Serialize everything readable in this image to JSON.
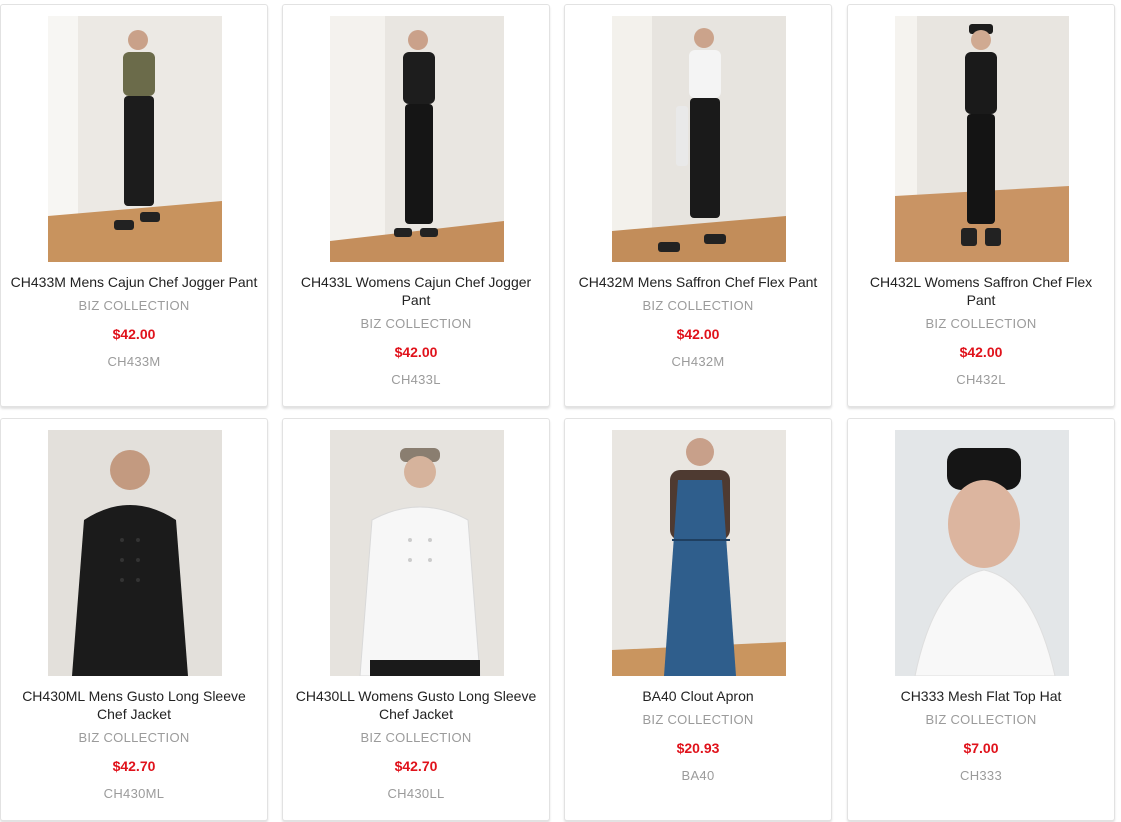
{
  "colors": {
    "price": "#e0121b",
    "muted": "#9b9b9b",
    "title": "#222222"
  },
  "products": [
    {
      "title": "CH433M Mens Cajun Chef Jogger Pant",
      "brand": "BIZ COLLECTION",
      "price": "$42.00",
      "sku": "CH433M",
      "image_icon": "person-standing-icon"
    },
    {
      "title": "CH433L Womens Cajun Chef Jogger Pant",
      "brand": "BIZ COLLECTION",
      "price": "$42.00",
      "sku": "CH433L",
      "image_icon": "person-standing-icon"
    },
    {
      "title": "CH432M Mens Saffron Chef Flex Pant",
      "brand": "BIZ COLLECTION",
      "price": "$42.00",
      "sku": "CH432M",
      "image_icon": "person-standing-icon"
    },
    {
      "title": "CH432L Womens Saffron Chef Flex Pant",
      "brand": "BIZ COLLECTION",
      "price": "$42.00",
      "sku": "CH432L",
      "image_icon": "person-standing-icon"
    },
    {
      "title": "CH430ML Mens Gusto Long Sleeve Chef Jacket",
      "brand": "BIZ COLLECTION",
      "price": "$42.70",
      "sku": "CH430ML",
      "image_icon": "person-jacket-icon"
    },
    {
      "title": "CH430LL Womens Gusto Long Sleeve Chef Jacket",
      "brand": "BIZ COLLECTION",
      "price": "$42.70",
      "sku": "CH430LL",
      "image_icon": "person-jacket-icon"
    },
    {
      "title": "BA40 Clout Apron",
      "brand": "BIZ COLLECTION",
      "price": "$20.93",
      "sku": "BA40",
      "image_icon": "person-apron-icon"
    },
    {
      "title": "CH333 Mesh Flat Top Hat",
      "brand": "BIZ COLLECTION",
      "price": "$7.00",
      "sku": "CH333",
      "image_icon": "person-hat-icon"
    }
  ]
}
